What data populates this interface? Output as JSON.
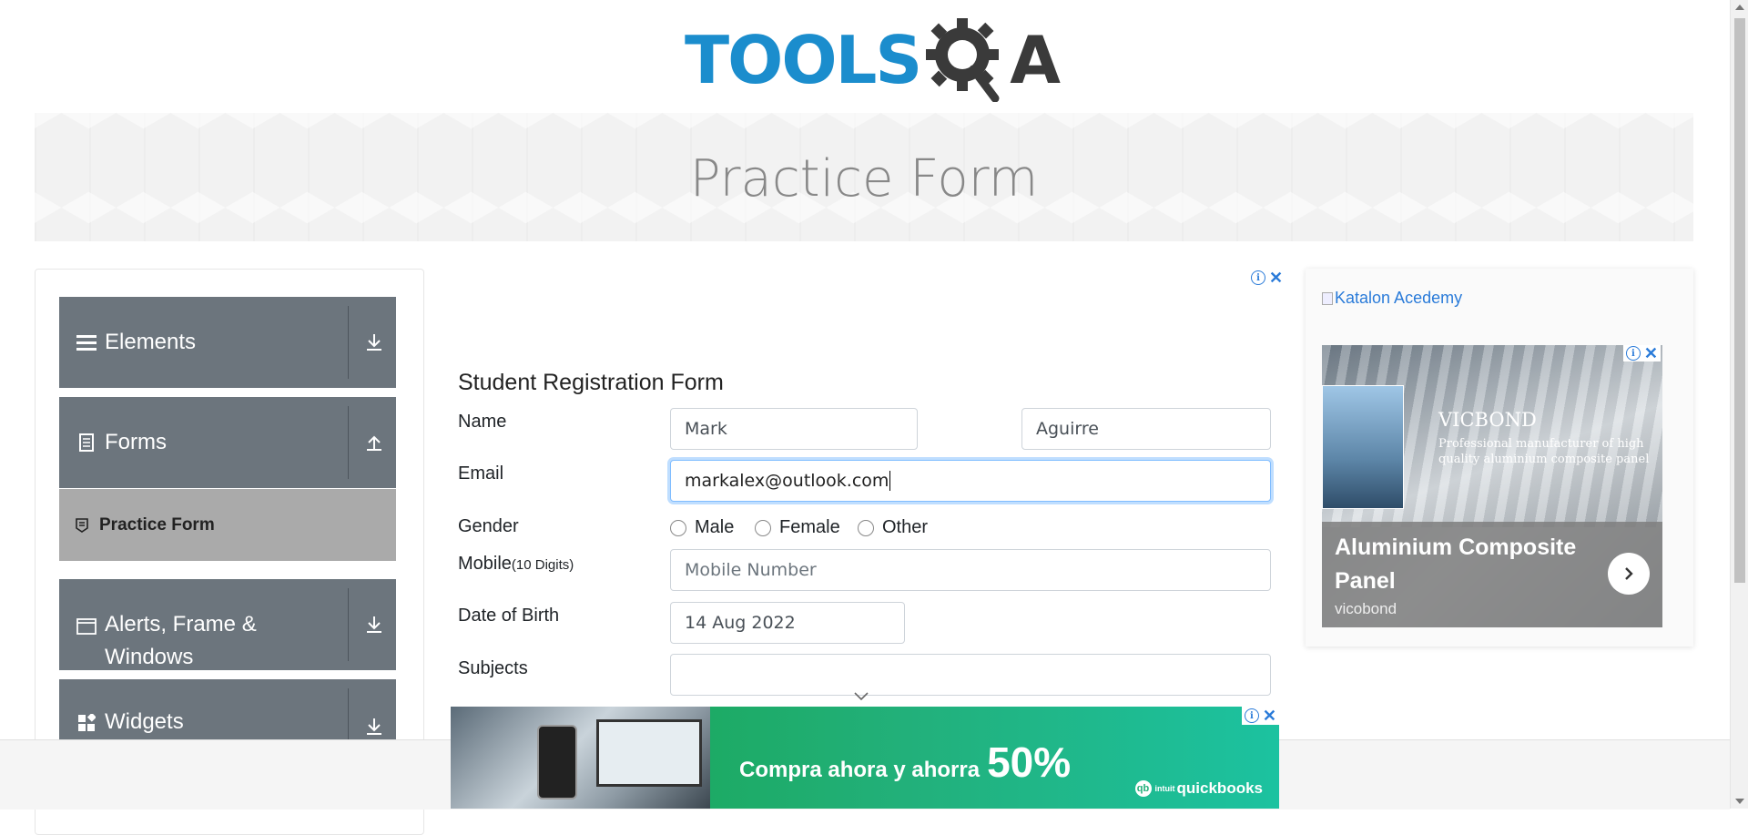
{
  "header": {
    "logo_text": "TOOLS",
    "logo_suffix": "A"
  },
  "banner": {
    "title": "Practice Form"
  },
  "sidebar": {
    "groups": [
      {
        "label": "Elements",
        "icon": "hamburger-icon",
        "arrow": "download-icon"
      },
      {
        "label": "Forms",
        "icon": "document-icon",
        "arrow": "upload-icon"
      },
      {
        "label": "Alerts, Frame & Windows",
        "icon": "window-icon",
        "arrow": "download-icon"
      },
      {
        "label": "Widgets",
        "icon": "widgets-icon",
        "arrow": "download-icon"
      }
    ],
    "active_item": {
      "label": "Practice Form",
      "icon": "form-icon"
    }
  },
  "form": {
    "title": "Student Registration Form",
    "name_label": "Name",
    "first_name": "Mark",
    "last_name": "Aguirre",
    "email_label": "Email",
    "email": "markalex@outlook.com",
    "gender_label": "Gender",
    "gender_options": [
      "Male",
      "Female",
      "Other"
    ],
    "mobile_label": "Mobile",
    "mobile_hint": "(10 Digits)",
    "mobile_placeholder": "Mobile Number",
    "dob_label": "Date of Birth",
    "dob": "14 Aug 2022",
    "subjects_label": "Subjects",
    "subjects": ""
  },
  "ads": {
    "katalon_alt": "Katalon Acedemy",
    "vicobond": {
      "brand": "VICBOND",
      "tagline": "Professional manufacturer of high quality aluminium composite panel",
      "headline": "Aluminium Composite Panel",
      "source": "vicobond"
    },
    "quickbooks": {
      "text": "Compra ahora y ahorra",
      "percent": "50%",
      "logo_prefix": "intuit",
      "logo": "quickbooks"
    },
    "info_glyph": "i",
    "close_glyph": "✕"
  },
  "colors": {
    "brand_blue": "#1b8dcd",
    "sidebar_bg": "#6c757d",
    "active_item_bg": "#aaaaaa",
    "focus_border": "#80bdff"
  }
}
